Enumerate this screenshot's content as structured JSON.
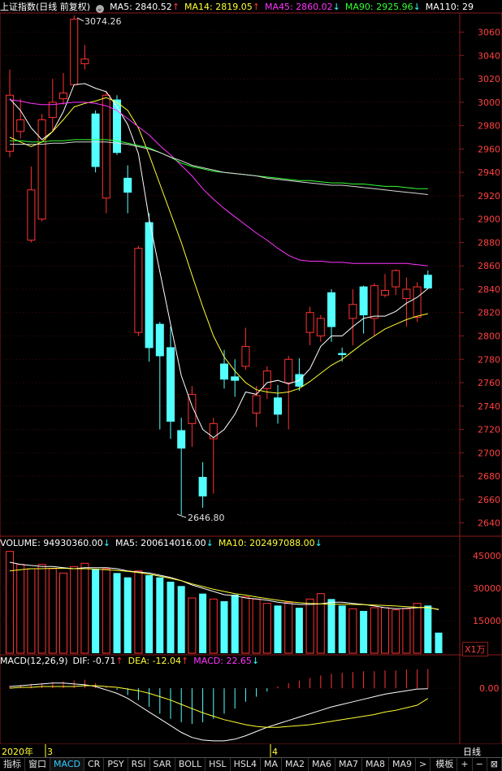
{
  "header": {
    "title": "上证指数(日线 前复权)",
    "ma_items": [
      {
        "label": "MA5: 2840.52",
        "arrow": "↑",
        "color": "#ffffff"
      },
      {
        "label": "MA14: 2819.05",
        "arrow": "↑",
        "color": "#ffff33"
      },
      {
        "label": "MA45: 2860.02",
        "arrow": "↓",
        "color": "#ff33ff"
      },
      {
        "label": "MA90: 2925.96",
        "arrow": "↓",
        "color": "#33ff33"
      },
      {
        "label": "MA110: 29",
        "arrow": "",
        "color": "#ffffff"
      }
    ],
    "arrow_up_color": "#ff3333",
    "arrow_down_color": "#33ffff"
  },
  "volume_header": {
    "items": [
      {
        "label": "VOLUME: 94930360.00",
        "arrow": "↓",
        "color": "#ffffff"
      },
      {
        "label": "MA5: 200614016.00",
        "arrow": "↓",
        "color": "#ffffff"
      },
      {
        "label": "MA10: 202497088.00",
        "arrow": "↓",
        "color": "#ffff33"
      }
    ],
    "unit": "X1万"
  },
  "macd_header": {
    "items": [
      {
        "label": "MACD(12,26,9)",
        "arrow": "",
        "color": "#ffffff"
      },
      {
        "label": "DIF: -0.71",
        "arrow": "↑",
        "color": "#ffffff"
      },
      {
        "label": "DEA: -12.04",
        "arrow": "↑",
        "color": "#ffff33"
      },
      {
        "label": "MACD: 22.65",
        "arrow": "↓",
        "color": "#ff33ff"
      }
    ]
  },
  "date_axis": {
    "labels": [
      "2020年",
      "3",
      "4"
    ],
    "period": "日线"
  },
  "tabs": [
    "指标",
    "窗口",
    "MACD",
    "CR",
    "PSY",
    "RSI",
    "SAR",
    "BOLL",
    "HSL",
    "HSL4",
    "MA",
    "MA2",
    "MA6",
    "MA7",
    "MA8",
    "MA9",
    ">",
    "模板",
    "+",
    "−",
    "⊠"
  ],
  "active_tab": "MACD",
  "annotations": {
    "high": "3074.26",
    "low": "2646.80"
  },
  "colors": {
    "up": "#ff3232",
    "down": "#54ffff",
    "grid": "#7a1a1a",
    "axis_text": "#ff4040"
  },
  "chart_data": [
    {
      "type": "candlestick",
      "title": "上证指数(日线 前复权)",
      "ylim": [
        2630,
        3075
      ],
      "yticks": [
        2640,
        2660,
        2680,
        2700,
        2720,
        2740,
        2760,
        2780,
        2800,
        2820,
        2840,
        2860,
        2880,
        2900,
        2920,
        2940,
        2960,
        2980,
        3000,
        3020,
        3040,
        3060
      ],
      "candles": [
        {
          "o": 2958,
          "c": 3006,
          "h": 3028,
          "l": 2953
        },
        {
          "o": 2975,
          "c": 2985,
          "h": 3003,
          "l": 2969
        },
        {
          "o": 2882,
          "c": 2925,
          "h": 2945,
          "l": 2880
        },
        {
          "o": 2900,
          "c": 2985,
          "h": 2990,
          "l": 2898
        },
        {
          "o": 2987,
          "c": 3000,
          "h": 3020,
          "l": 2975
        },
        {
          "o": 3003,
          "c": 3008,
          "h": 3025,
          "l": 2998
        },
        {
          "o": 3015,
          "c": 3071,
          "h": 3074.26,
          "l": 3015
        },
        {
          "o": 3033,
          "c": 3037,
          "h": 3049,
          "l": 3028
        },
        {
          "o": 2990,
          "c": 2945,
          "h": 2993,
          "l": 2940
        },
        {
          "o": 2918,
          "c": 3006,
          "h": 3010,
          "l": 2905
        },
        {
          "o": 3002,
          "c": 2957,
          "h": 3006,
          "l": 2955
        },
        {
          "o": 2935,
          "c": 2923,
          "h": 2946,
          "l": 2905
        },
        {
          "o": 2803,
          "c": 2875,
          "h": 2877,
          "l": 2800
        },
        {
          "o": 2897,
          "c": 2790,
          "h": 2905,
          "l": 2778
        },
        {
          "o": 2810,
          "c": 2783,
          "h": 2812,
          "l": 2720
        },
        {
          "o": 2790,
          "c": 2727,
          "h": 2808,
          "l": 2712
        },
        {
          "o": 2719,
          "c": 2704,
          "h": 2730,
          "l": 2646.8
        },
        {
          "o": 2725,
          "c": 2750,
          "h": 2757,
          "l": 2705
        },
        {
          "o": 2679,
          "c": 2663,
          "h": 2692,
          "l": 2653
        },
        {
          "o": 2712,
          "c": 2725,
          "h": 2730,
          "l": 2665
        },
        {
          "o": 2776,
          "c": 2763,
          "h": 2788,
          "l": 2755
        },
        {
          "o": 2765,
          "c": 2762,
          "h": 2780,
          "l": 2748
        },
        {
          "o": 2774,
          "c": 2791,
          "h": 2807,
          "l": 2771
        },
        {
          "o": 2734,
          "c": 2749,
          "h": 2757,
          "l": 2722
        },
        {
          "o": 2755,
          "c": 2770,
          "h": 2774,
          "l": 2746
        },
        {
          "o": 2747,
          "c": 2733,
          "h": 2758,
          "l": 2725
        },
        {
          "o": 2760,
          "c": 2780,
          "h": 2783,
          "l": 2720
        },
        {
          "o": 2767,
          "c": 2757,
          "h": 2781,
          "l": 2753
        },
        {
          "o": 2803,
          "c": 2820,
          "h": 2825,
          "l": 2792
        },
        {
          "o": 2800,
          "c": 2815,
          "h": 2818,
          "l": 2795
        },
        {
          "o": 2837,
          "c": 2808,
          "h": 2840,
          "l": 2795
        },
        {
          "o": 2785,
          "c": 2784,
          "h": 2790,
          "l": 2778
        },
        {
          "o": 2815,
          "c": 2827,
          "h": 2840,
          "l": 2792
        },
        {
          "o": 2842,
          "c": 2818,
          "h": 2843,
          "l": 2802
        },
        {
          "o": 2815,
          "c": 2843,
          "h": 2845,
          "l": 2800
        },
        {
          "o": 2835,
          "c": 2839,
          "h": 2853,
          "l": 2833
        },
        {
          "o": 2842,
          "c": 2856,
          "h": 2857,
          "l": 2835
        },
        {
          "o": 2832,
          "c": 2840,
          "h": 2850,
          "l": 2808
        },
        {
          "o": 2816,
          "c": 2842,
          "h": 2846,
          "l": 2812
        },
        {
          "o": 2852,
          "c": 2841,
          "h": 2856,
          "l": 2840
        }
      ],
      "series": [
        {
          "name": "MA5",
          "color": "#ffffff",
          "values": [
            3003,
            2993,
            2978,
            2968,
            2975,
            2992,
            3015,
            3016,
            3012,
            3009,
            2996,
            2981,
            2956,
            2900,
            2855,
            2810,
            2766,
            2740,
            2720,
            2713,
            2720,
            2733,
            2752,
            2750,
            2760,
            2762,
            2759,
            2762,
            2772,
            2791,
            2800,
            2800,
            2808,
            2815,
            2817,
            2817,
            2821,
            2828,
            2833,
            2840.52
          ]
        },
        {
          "name": "MA14",
          "color": "#ffff33",
          "values": [
            2970,
            2966,
            2962,
            2966,
            2975,
            2985,
            2996,
            2999,
            3001,
            3004,
            3000,
            2993,
            2978,
            2955,
            2930,
            2905,
            2880,
            2852,
            2825,
            2800,
            2782,
            2770,
            2760,
            2754,
            2752,
            2751,
            2752,
            2755,
            2761,
            2768,
            2775,
            2780,
            2787,
            2794,
            2800,
            2806,
            2810,
            2814,
            2817,
            2819.05
          ]
        },
        {
          "name": "MA45",
          "color": "#ff33ff",
          "values": [
            3002,
            3001,
            2999,
            2998,
            2998,
            2999,
            3000,
            3000,
            2999,
            2997,
            2993,
            2986,
            2979,
            2972,
            2963,
            2955,
            2946,
            2937,
            2926,
            2917,
            2909,
            2902,
            2895,
            2888,
            2882,
            2875,
            2869,
            2865,
            2864,
            2864,
            2863,
            2863,
            2862,
            2862,
            2862,
            2862,
            2862,
            2862,
            2861,
            2860.02
          ]
        },
        {
          "name": "MA90",
          "color": "#33ff33",
          "values": [
            2967,
            2967,
            2966,
            2966,
            2967,
            2967,
            2968,
            2968,
            2968,
            2968,
            2967,
            2965,
            2963,
            2961,
            2957,
            2953,
            2948,
            2945,
            2943,
            2941,
            2940,
            2939,
            2938,
            2937,
            2936,
            2935,
            2934,
            2933,
            2933,
            2932,
            2931,
            2931,
            2930,
            2930,
            2929,
            2928,
            2928,
            2927,
            2926,
            2925.96
          ]
        },
        {
          "name": "MA110",
          "color": "#d8d8d8",
          "values": [
            2964,
            2964,
            2964,
            2964,
            2965,
            2965,
            2966,
            2966,
            2966,
            2966,
            2965,
            2964,
            2962,
            2960,
            2957,
            2953,
            2950,
            2946,
            2944,
            2942,
            2940,
            2939,
            2938,
            2937,
            2935,
            2934,
            2933,
            2932,
            2931,
            2930,
            2929,
            2929,
            2928,
            2927,
            2926,
            2925,
            2924,
            2923,
            2922,
            2921
          ]
        }
      ]
    },
    {
      "type": "bar",
      "title": "VOLUME",
      "ylim": [
        0,
        48000
      ],
      "yticks": [
        15000,
        30000,
        45000
      ],
      "values": [
        47000,
        41000,
        39000,
        41000,
        39000,
        37000,
        40000,
        41500,
        39000,
        39000,
        37000,
        35000,
        38000,
        36000,
        35000,
        33000,
        31000,
        25500,
        27500,
        25000,
        24000,
        27000,
        26000,
        25000,
        23000,
        22000,
        23500,
        21000,
        25000,
        27500,
        25000,
        22000,
        20500,
        19500,
        21000,
        21000,
        20000,
        20500,
        23000,
        22000,
        9493
      ],
      "series": [
        {
          "name": "MA5",
          "color": "#ffffff",
          "values": [
            42000,
            41000,
            40500,
            40000,
            40000,
            39500,
            39000,
            39500,
            39500,
            39500,
            39000,
            38000,
            37500,
            37000,
            36000,
            35000,
            33500,
            31500,
            30000,
            28500,
            27000,
            26500,
            25500,
            25000,
            24500,
            23500,
            23000,
            22500,
            22500,
            22800,
            23500,
            23500,
            23000,
            22500,
            21800,
            21000,
            20500,
            20700,
            21000,
            21200,
            20061
          ]
        },
        {
          "name": "MA10",
          "color": "#ffff33",
          "values": [
            38000,
            38500,
            39000,
            39000,
            39200,
            39200,
            39000,
            39000,
            38800,
            38500,
            38200,
            37800,
            37200,
            36500,
            35500,
            34500,
            33500,
            32000,
            30800,
            29500,
            28500,
            27500,
            26800,
            26000,
            25200,
            24500,
            23800,
            23300,
            23000,
            22800,
            22600,
            22600,
            22500,
            22400,
            22200,
            22000,
            21800,
            21500,
            21200,
            21000,
            20250
          ]
        }
      ]
    },
    {
      "type": "bar",
      "title": "MACD(12,26,9)",
      "ylim": [
        -64,
        24
      ],
      "yticks": [
        0
      ],
      "values": [
        3,
        4,
        5,
        6,
        7,
        8,
        9,
        10,
        6,
        2,
        -2,
        -8,
        -14,
        -22,
        -30,
        -36,
        -40,
        -42,
        -40,
        -36,
        -30,
        -24,
        -16,
        -10,
        -4,
        2,
        6,
        9,
        12,
        15,
        17,
        18,
        19,
        20,
        20,
        21,
        21,
        22,
        22,
        22.65
      ],
      "series": [
        {
          "name": "DIF",
          "color": "#ffffff",
          "values": [
            2,
            3,
            4,
            5,
            6,
            6,
            5,
            4,
            2,
            -2,
            -6,
            -12,
            -20,
            -28,
            -36,
            -44,
            -52,
            -58,
            -61,
            -62,
            -62,
            -60,
            -56,
            -51,
            -46,
            -42,
            -38,
            -34,
            -30,
            -26,
            -22,
            -19,
            -16,
            -13,
            -10,
            -7,
            -5,
            -3,
            -1,
            -0.71
          ]
        },
        {
          "name": "DEA",
          "color": "#ffff33",
          "values": [
            0,
            1,
            1,
            2,
            2,
            2,
            2,
            3,
            3,
            2,
            1,
            -1,
            -3,
            -6,
            -10,
            -14,
            -19,
            -24,
            -29,
            -33,
            -37,
            -40,
            -43,
            -45,
            -46,
            -46,
            -45,
            -44,
            -43,
            -41,
            -39,
            -37,
            -35,
            -33,
            -31,
            -28,
            -26,
            -23,
            -20,
            -12.04
          ]
        }
      ]
    }
  ]
}
